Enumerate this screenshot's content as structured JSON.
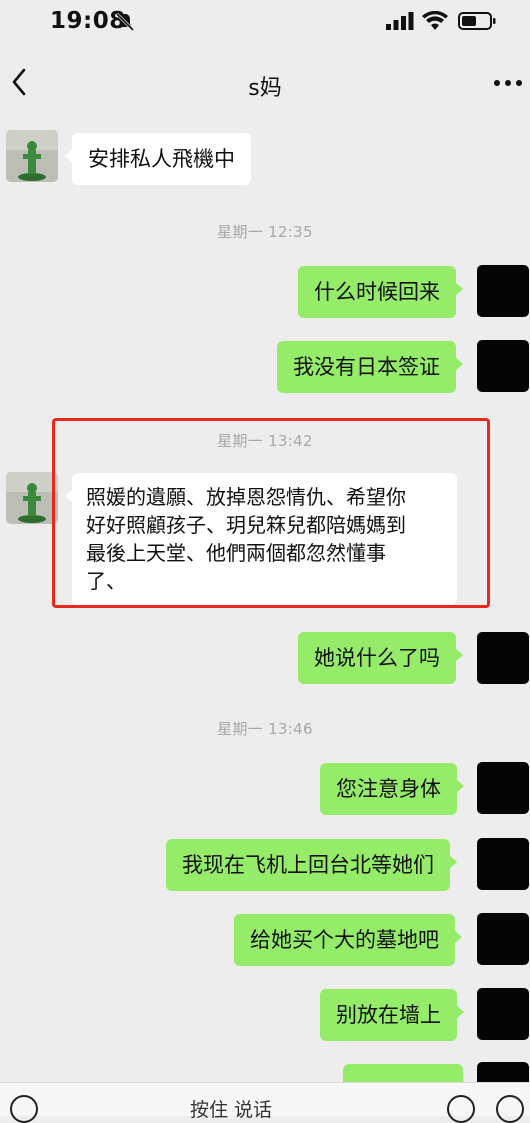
{
  "status_bar": {
    "time": "19:08"
  },
  "nav": {
    "title": "s妈"
  },
  "messages": [
    {
      "text": "安排私人飛機中"
    },
    {
      "text": "星期一 12:35"
    },
    {
      "text": "什么时候回来"
    },
    {
      "text": "我没有日本签证"
    },
    {
      "text": "星期一 13:42"
    },
    {
      "lines": [
        "照媛的遺願、放掉恩怨情仇、希望你",
        "好好照顧孩子、玥兒箖兒都陪媽媽到",
        "最後上天堂、他們兩個都忽然懂事",
        "了、"
      ]
    },
    {
      "text": "她说什么了吗"
    },
    {
      "text": "星期一 13:46"
    },
    {
      "text": "您注意身体"
    },
    {
      "text": "我现在飞机上回台北等她们"
    },
    {
      "text": "给她买个大的墓地吧"
    },
    {
      "text": "别放在墙上"
    }
  ],
  "input_bar": {
    "hint": "按住 说话"
  },
  "colors": {
    "outgoing_bubble": "#95ec69",
    "incoming_bubble": "#ffffff",
    "background": "#ededed",
    "highlight": "#e8281c"
  }
}
